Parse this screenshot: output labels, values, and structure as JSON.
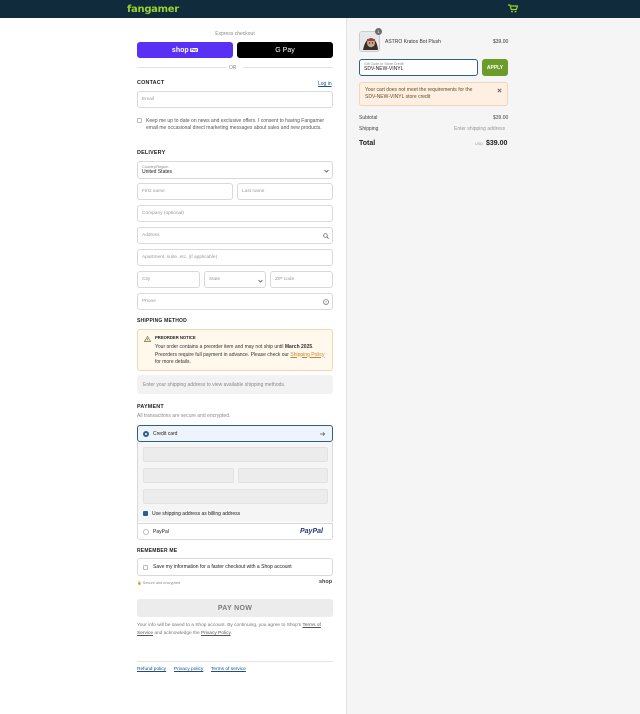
{
  "header": {
    "brand": "fangamer"
  },
  "express": {
    "title": "Express checkout",
    "shop_label": "shop",
    "shop_pay_tag": "Pay",
    "gpay_label": "G Pay",
    "or": "OR"
  },
  "contact": {
    "title": "CONTACT",
    "login": "Log in",
    "email_placeholder": "Email",
    "news_consent": "Keep me up to date on news and exclusive offers. I consent to having Fangamer email me occasional direct marketing messages about sales and new products."
  },
  "delivery": {
    "title": "DELIVERY",
    "country_label": "Country/Region",
    "country_value": "United States",
    "first_name": "First name",
    "last_name": "Last name",
    "company": "Company (optional)",
    "address": "Address",
    "apartment": "Apartment, suite, etc. (if applicable)",
    "city": "City",
    "state": "State",
    "zip": "ZIP code",
    "phone": "Phone"
  },
  "shipping": {
    "title": "SHIPPING METHOD",
    "notice_title": "PREORDER NOTICE",
    "notice_pre": "Your order contains a preorder item and may not ship until",
    "notice_date": "March 2025",
    "notice_mid": ". Preorders require full payment in advance. Please check our",
    "notice_link": "Shipping Policy",
    "notice_post": "for more details.",
    "placeholder": "Enter your shipping address to view available shipping methods."
  },
  "payment": {
    "title": "PAYMENT",
    "subtitle": "All transactions are secure and encrypted.",
    "credit_card": "Credit card",
    "billing_same": "Use shipping address as billing address",
    "paypal": "PayPal",
    "paypal_logo": "PayPal"
  },
  "remember": {
    "title": "REMEMBER ME",
    "option": "Save my information for a faster checkout with a Shop account",
    "secure": "Secure and encrypted",
    "shop": "shop"
  },
  "pay_now": "PAY NOW",
  "legal": {
    "pre": "Your info will be saved to a Shop account. By continuing, you agree to Shop's",
    "terms": "Terms of Service",
    "mid": "and acknowledge the",
    "privacy": "Privacy Policy",
    "end": "."
  },
  "footer": {
    "refund": "Refund policy",
    "privacy": "Privacy policy",
    "terms": "Terms of service"
  },
  "summary": {
    "item_qty": "1",
    "item_name": "ASTRO Kratos Bot Plush",
    "item_price": "$39.00",
    "gift_label": "Gift Code or Store Credit",
    "gift_value": "SDV-NEW-VINYL",
    "apply": "APPLY",
    "warning": "Your cart does not meet the requirements for the SDV-NEW-VINYL store credit",
    "subtotal_label": "Subtotal",
    "subtotal_value": "$39.00",
    "shipping_label": "Shipping",
    "shipping_value": "Enter shipping address",
    "total_label": "Total",
    "currency": "USD",
    "total_value": "$39.00"
  },
  "colors": {
    "brand": "#9ad22d",
    "header": "#102b3c",
    "accent": "#2f5d8a",
    "apply": "#6b9b28",
    "shop_pay": "#5a31f4"
  }
}
